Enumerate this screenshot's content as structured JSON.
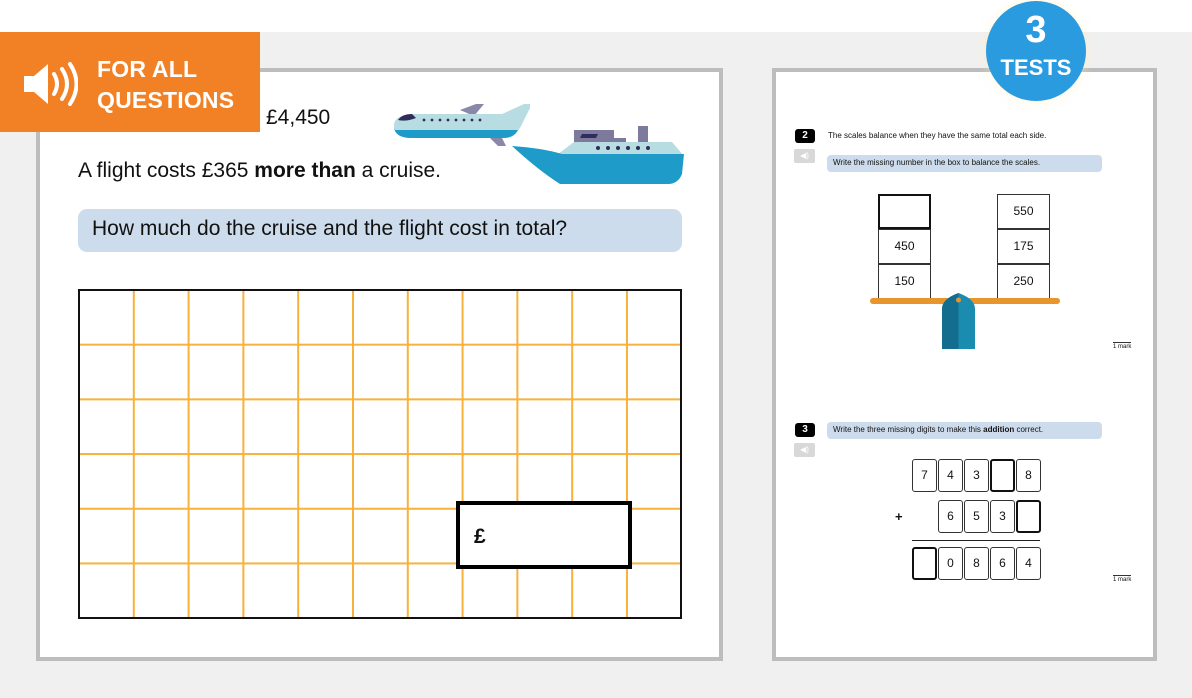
{
  "banner": {
    "icon": "speaker-icon",
    "line1": "FOR ALL",
    "line2": "QUESTIONS",
    "color": "#f28024"
  },
  "badge": {
    "number": "3",
    "label": "TESTS",
    "color": "#2b9be0"
  },
  "left_card": {
    "price": "£4,450",
    "statement_pre": "A flight costs £365 ",
    "statement_bold": "more than",
    "statement_post": " a cruise.",
    "question": "How much do the cruise and the flight cost in total?",
    "images": [
      "plane-illustration",
      "cruise-ship-illustration"
    ],
    "grid": {
      "columns": 11,
      "rows": 6,
      "line_color": "#f6b23a"
    },
    "answer_prefix": "£",
    "answer_value": ""
  },
  "right_card": {
    "q2": {
      "number": "2",
      "intro": "The scales balance when they have the same total each side.",
      "prompt": "Write the missing number in the box to balance the scales.",
      "left_pan": [
        "",
        "450",
        "150"
      ],
      "right_pan": [
        "550",
        "175",
        "250"
      ],
      "marks": "1 mark"
    },
    "q3": {
      "number": "3",
      "prompt_pre": "Write the three missing digits to make this ",
      "prompt_bold": "addition",
      "prompt_post": " correct.",
      "row1": [
        "7",
        "4",
        "3",
        "",
        "8"
      ],
      "operator": "+",
      "row2": [
        "6",
        "5",
        "3",
        ""
      ],
      "result": [
        "",
        "0",
        "8",
        "6",
        "4"
      ],
      "marks": "1 mark"
    }
  }
}
